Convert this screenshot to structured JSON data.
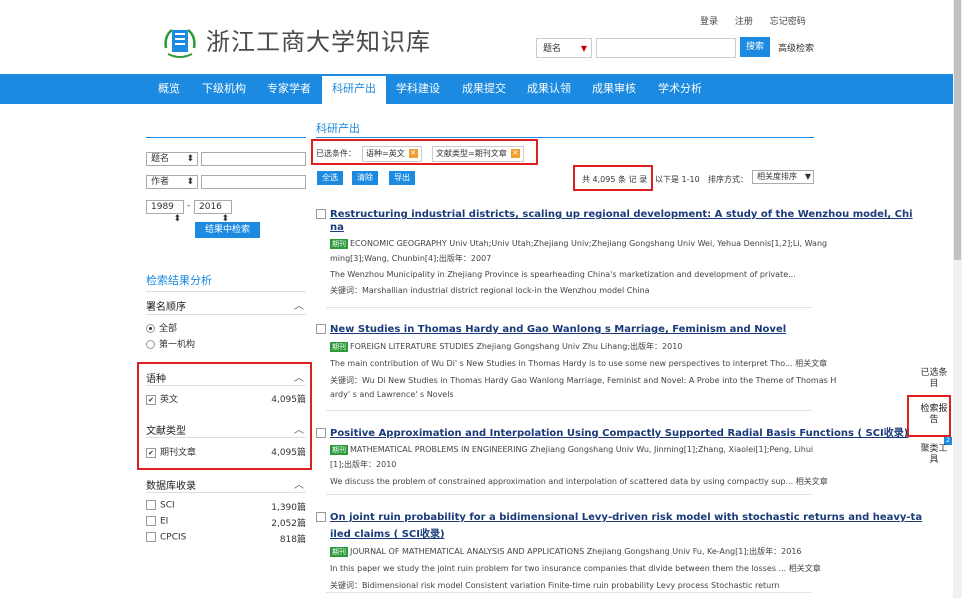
{
  "header": {
    "site_title": "浙江工商大学知识库",
    "links": [
      "登录",
      "注册",
      "忘记密码"
    ],
    "search_field": "题名",
    "search_button": "搜索",
    "advanced_search": "高级检索"
  },
  "nav": {
    "items": [
      "概览",
      "下级机构",
      "专家学者",
      "科研产出",
      "学科建设",
      "成果提交",
      "成果认领",
      "成果审核",
      "学术分析"
    ],
    "active": "科研产出"
  },
  "left": {
    "filter1_field": "题名",
    "filter2_field": "作者",
    "year_from": "1989",
    "year_sep": "-",
    "year_to": "2016",
    "search_in_results": "结果中检索",
    "analysis_title": "检索结果分析",
    "author_order": {
      "title": "署名顺序",
      "options": [
        "全部",
        "第一机构"
      ]
    },
    "language": {
      "title": "语种",
      "items": [
        {
          "label": "英文",
          "count": "4,095篇"
        }
      ]
    },
    "doc_type": {
      "title": "文献类型",
      "items": [
        {
          "label": "期刊文章",
          "count": "4,095篇"
        }
      ]
    },
    "db": {
      "title": "数据库收录",
      "items": [
        {
          "label": "SCI",
          "count": "1,390篇"
        },
        {
          "label": "EI",
          "count": "2,052篇"
        },
        {
          "label": "CPCIS",
          "count": "818篇"
        }
      ]
    }
  },
  "main": {
    "section_title": "科研产出",
    "conditions_label": "已选条件：",
    "tags": [
      "语种=英文",
      "文献类型=期刊文章"
    ],
    "buttons": [
      "全选",
      "清除",
      "导出"
    ],
    "total": "共 4,095 条 记 录",
    "range": "以下是 1-10",
    "sort_label": "排序方式：",
    "sort_value": "相关度排序",
    "journal_tag": "期刊",
    "results": [
      {
        "title_l1": "Restructuring industrial districts, scaling up regional development: A study of the Wenzhou model, Chi",
        "title_l2": "na",
        "meta_l1": "ECONOMIC GEOGRAPHY    Univ Utah;Univ Utah;Zhejiang Univ;Zhejiang Gongshang Univ Wei, Yehua Dennis[1,2];Li, Wang",
        "meta_l2": "ming[3];Wang, Chunbin[4];出版年：2007",
        "abstract": "The Wenzhou Municipality in Zhejiang Province is spearheading China's marketization and development of private...",
        "keywords": "关键词：Marshallian industrial district   regional lock-in   the Wenzhou model   China"
      },
      {
        "title_l1": "New Studies in Thomas Hardy and Gao Wanlong s Marriage, Feminism and Novel",
        "meta_l1": "FOREIGN LITERATURE STUDIES    Zhejiang Gongshang Univ Zhu Lihang;出版年：2010",
        "abstract": "The main contribution of Wu Di' s New Studies in Thomas Hardy is to use some new perspectives to interpret Tho...   相关文章",
        "keywords": "关键词：Wu Di   New Studies in Thomas Hardy   Gao Wanlong   Marriage, Feminist and Novel: A Probe into the Theme of Thomas H",
        "keywords_l2": "ardy' s and Lawrence' s Novels"
      },
      {
        "title_l1": "Positive Approximation and Interpolation Using Compactly Supported Radial Basis Functions ( SCI收录)",
        "meta_l1": "MATHEMATICAL PROBLEMS IN ENGINEERING    Zhejiang Gongshang Univ Wu, Jinming[1];Zhang, Xiaolei[1];Peng, Lihui",
        "meta_l2": "[1];出版年：2010",
        "abstract": "We discuss the problem of constrained approximation and interpolation of scattered data by using compactly sup...   相关文章"
      },
      {
        "title_l1": "On joint ruin probability for a bidimensional Levy-driven risk model with stochastic returns and heavy-ta",
        "title_l2": "iled claims ( SCI收录)",
        "meta_l1": "JOURNAL OF MATHEMATICAL ANALYSIS AND APPLICATIONS    Zhejiang Gongshang Univ Fu, Ke-Ang[1];出版年：2016",
        "abstract": "In this paper we study the joint ruin problem for two insurance companies that divide between them the losses ...   相关文章",
        "keywords": "关键词：Bidimensional risk model   Consistent variation   Finite-time ruin probability   Levy process   Stochastic return"
      }
    ]
  },
  "float": {
    "selected": "已选条目",
    "report": "检索报告",
    "cluster": "聚类工具",
    "badge": "2"
  },
  "colors": {
    "primary": "#1b8ae0",
    "highlight_box": "#e02020",
    "journal_tag": "#2a9a3a"
  }
}
